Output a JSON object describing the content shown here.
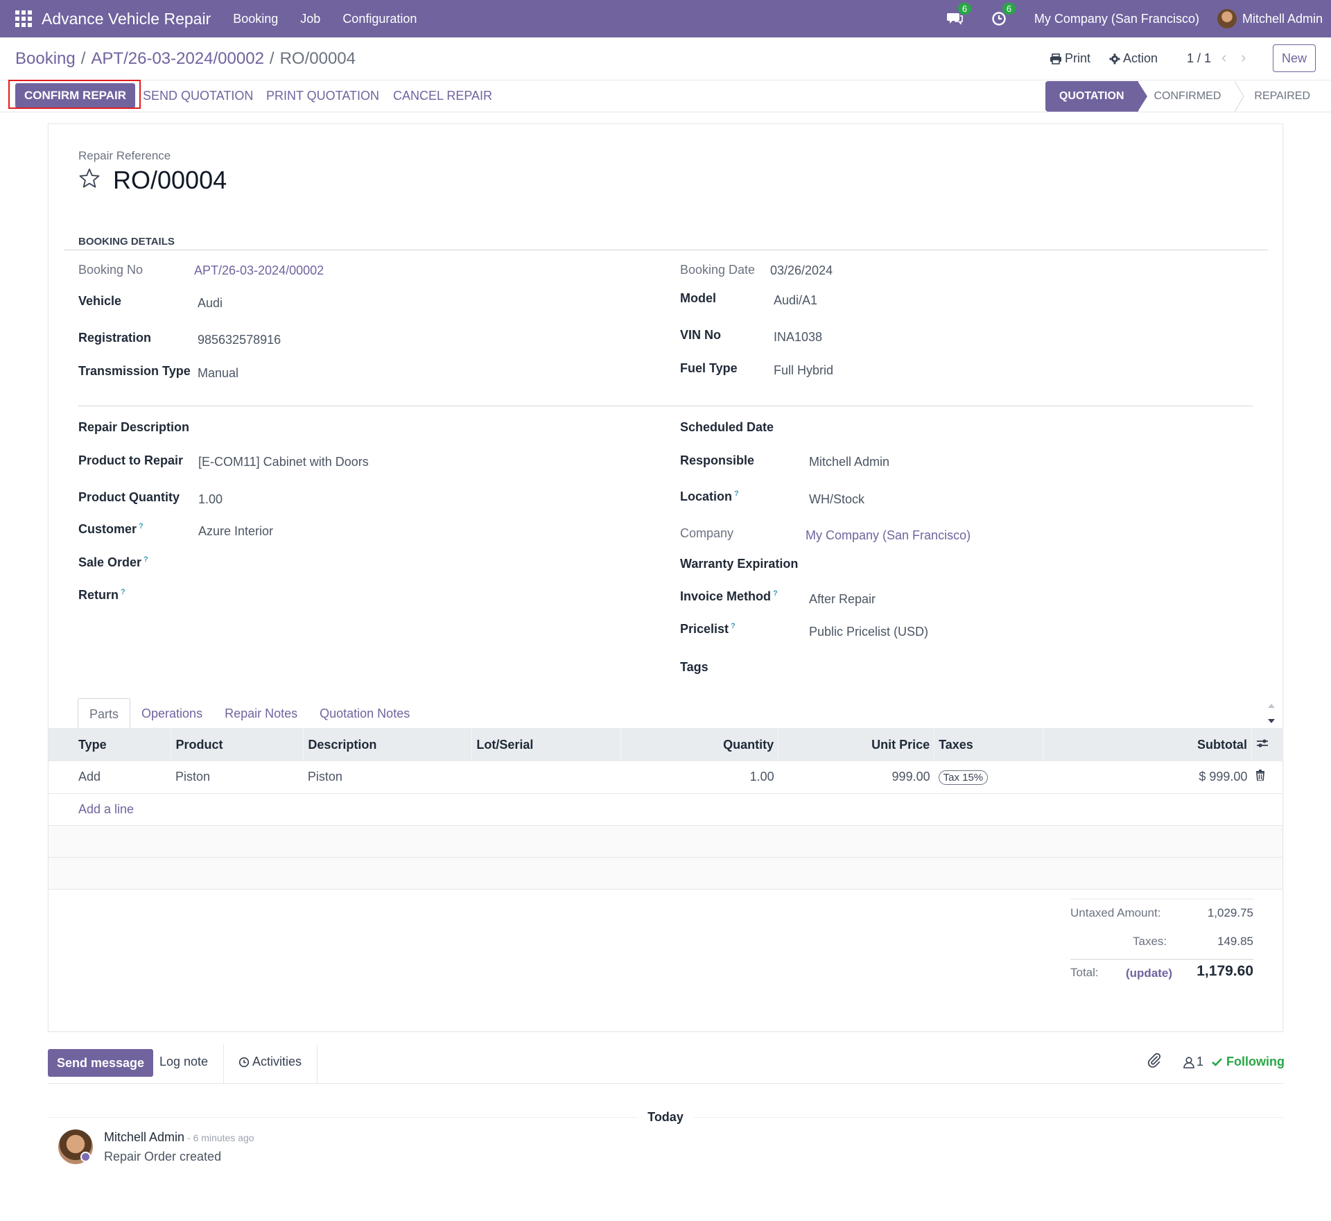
{
  "navbar": {
    "app_title": "Advance Vehicle Repair",
    "menu": [
      "Booking",
      "Job",
      "Configuration"
    ],
    "messages_count": "6",
    "activities_count": "6",
    "company": "My Company (San Francisco)",
    "user": "Mitchell Admin",
    "brand_color": "#71639e"
  },
  "breadcrumb": {
    "root": "Booking",
    "parent": "APT/26-03-2024/00002",
    "current": "RO/00004"
  },
  "controls": {
    "print": "Print",
    "action": "Action",
    "pager": "1 / 1",
    "new": "New"
  },
  "statusbar": {
    "confirm": "CONFIRM REPAIR",
    "send_quotation": "SEND QUOTATION",
    "print_quotation": "PRINT QUOTATION",
    "cancel": "CANCEL REPAIR",
    "stages": [
      "QUOTATION",
      "CONFIRMED",
      "REPAIRED"
    ],
    "active_stage": "QUOTATION"
  },
  "form": {
    "ref_label": "Repair Reference",
    "ref": "RO/00004",
    "section_booking": "BOOKING DETAILS",
    "booking_no_label": "Booking No",
    "booking_no": "APT/26-03-2024/00002",
    "vehicle_label": "Vehicle",
    "vehicle": "Audi",
    "registration_label": "Registration",
    "registration": "985632578916",
    "transmission_label": "Transmission Type",
    "transmission": "Manual",
    "booking_date_label": "Booking Date",
    "booking_date": "03/26/2024",
    "model_label": "Model",
    "model": "Audi/A1",
    "vin_label": "VIN No",
    "vin": "INA1038",
    "fuel_label": "Fuel Type",
    "fuel": "Full Hybrid",
    "repair_desc_label": "Repair Description",
    "product_label": "Product to Repair",
    "product": "[E-COM11] Cabinet with Doors",
    "qty_label": "Product Quantity",
    "qty": "1.00",
    "customer_label": "Customer",
    "customer": "Azure Interior",
    "sale_order_label": "Sale Order",
    "return_label": "Return",
    "scheduled_label": "Scheduled Date",
    "responsible_label": "Responsible",
    "responsible": "Mitchell Admin",
    "location_label": "Location",
    "location": "WH/Stock",
    "company_label": "Company",
    "company": "My Company (San Francisco)",
    "warranty_label": "Warranty Expiration",
    "invoice_label": "Invoice Method",
    "invoice": "After Repair",
    "pricelist_label": "Pricelist",
    "pricelist": "Public Pricelist (USD)",
    "tags_label": "Tags"
  },
  "tabs": [
    "Parts",
    "Operations",
    "Repair Notes",
    "Quotation Notes"
  ],
  "lines": {
    "headers": [
      "Type",
      "Product",
      "Description",
      "Lot/Serial",
      "Quantity",
      "Unit Price",
      "Taxes",
      "Subtotal"
    ],
    "rows": [
      {
        "type": "Add",
        "product": "Piston",
        "description": "Piston",
        "lot": "",
        "quantity": "1.00",
        "unit_price": "999.00",
        "tax": "Tax 15%",
        "subtotal": "$ 999.00"
      }
    ],
    "add_line": "Add a line"
  },
  "totals": {
    "untaxed_label": "Untaxed Amount:",
    "untaxed": "1,029.75",
    "taxes_label": "Taxes:",
    "taxes": "149.85",
    "total_label": "Total:",
    "update": "(update)",
    "total": "1,179.60"
  },
  "chatter": {
    "send_message": "Send message",
    "log_note": "Log note",
    "activities": "Activities",
    "followers": "1",
    "following": "Following",
    "today": "Today",
    "author": "Mitchell Admin",
    "time": "- 6 minutes ago",
    "body": "Repair Order created"
  }
}
